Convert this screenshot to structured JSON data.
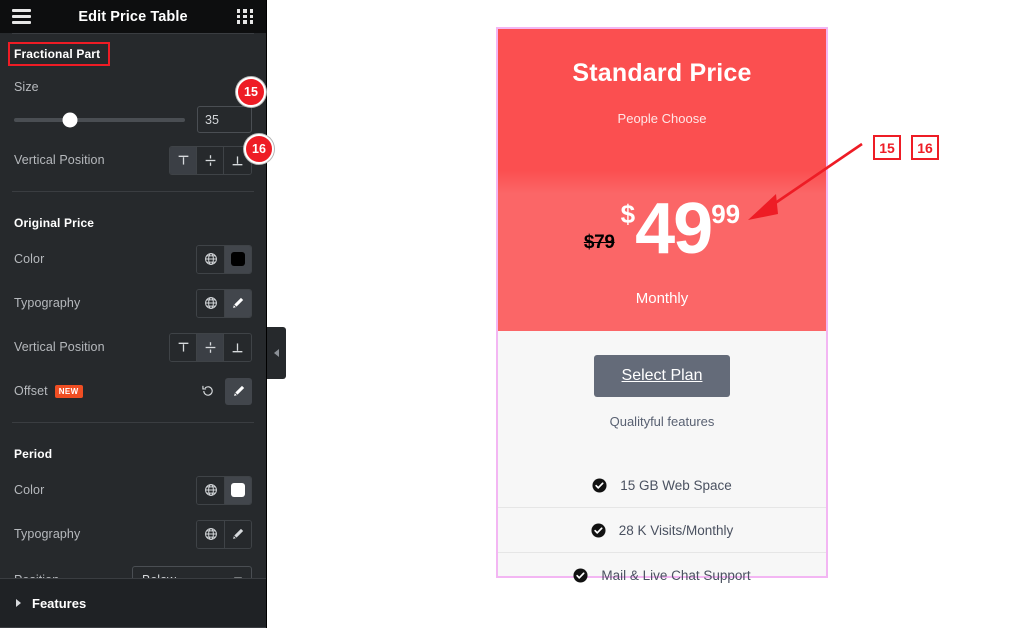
{
  "panel": {
    "title": "Edit Price Table",
    "menu_icon": "hamburger-icon",
    "apps_icon": "grid-apps-icon",
    "sections": {
      "fractional": {
        "title": "Fractional Part",
        "size_label": "Size",
        "size_value": "35",
        "vertical_position_label": "Vertical Position",
        "vertical_position_active": "top",
        "marker": "15",
        "marker2": "16"
      },
      "original_price": {
        "title": "Original Price",
        "color_label": "Color",
        "color_value": "#000000",
        "typography_label": "Typography",
        "vertical_position_label": "Vertical Position",
        "vertical_position_active": "middle",
        "offset_label": "Offset",
        "offset_badge": "NEW"
      },
      "period": {
        "title": "Period",
        "color_label": "Color",
        "color_value": "#ffffff",
        "typography_label": "Typography",
        "position_label": "Position",
        "position_value": "Below"
      }
    },
    "features_label": "Features",
    "collapse_icon": "chevron-left-icon"
  },
  "annotations": {
    "badge_15": "15",
    "badge_16": "16",
    "box_15": "15",
    "box_16": "16",
    "accent_color": "#ee1c25"
  },
  "card": {
    "heading": "Standard Price",
    "subheading": "People Choose",
    "original_price": "$79",
    "currency": "$",
    "integer": "49",
    "fraction": "99",
    "period": "Monthly",
    "cta_label": "Select Plan",
    "cta_sub": "Qualityful features",
    "features": [
      {
        "icon": "check-circle-icon",
        "text": "15 GB Web Space"
      },
      {
        "icon": "check-circle-icon",
        "text": "28 K Visits/Monthly"
      },
      {
        "icon": "check-circle-icon",
        "text": "Mail & Live Chat Support"
      }
    ],
    "header_color": "#fb4f50",
    "price_color": "#fb6667",
    "border_color": "#f3b6f3",
    "cta_color": "#646b79"
  }
}
